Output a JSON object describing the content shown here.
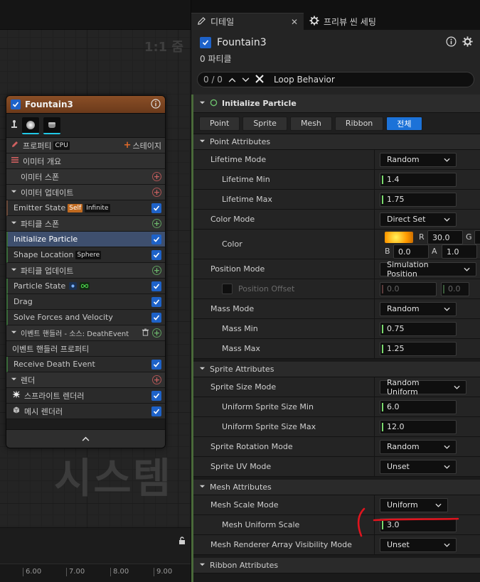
{
  "graph": {
    "zoom_label": "1:1 줌",
    "watermark": "시스템",
    "ticks": [
      "6.00",
      "7.00",
      "8.00",
      "9.00"
    ]
  },
  "node": {
    "title": "Fountain3",
    "properties_label": "프로퍼티",
    "cpu_badge": "CPU",
    "add_stage_label": "스테이지",
    "rows": {
      "emitter_summary": "이미터 개요",
      "emitter_spawn": "이미터 스폰",
      "emitter_update": "이미터 업데이트",
      "emitter_state": "Emitter State",
      "emitter_state_tag1": "Self",
      "emitter_state_tag2": "Infinite",
      "particle_spawn": "파티클 스폰",
      "initialize_particle": "Initialize Particle",
      "shape_location": "Shape Location",
      "shape_location_tag": "Sphere",
      "particle_update": "파티클 업데이트",
      "particle_state": "Particle State",
      "drag": "Drag",
      "solve_forces": "Solve Forces and Velocity",
      "event_handler": "이벤트 핸들러 - 소스: DeathEvent",
      "event_handler_props": "이벤트 핸들러 프로퍼티",
      "receive_death": "Receive Death Event",
      "render": "렌더",
      "sprite_renderer": "스프라이트 렌더러",
      "mesh_renderer": "메시 렌더러"
    }
  },
  "details": {
    "tab_details": "디테일",
    "tab_preview": "프리뷰 씬 세팅",
    "object_name": "Fountain3",
    "particle_count": "0 파티클",
    "search_count": "0 / 0",
    "search_text": "Loop Behavior",
    "category": "Initialize Particle",
    "filters": [
      "Point",
      "Sprite",
      "Mesh",
      "Ribbon",
      "전체"
    ],
    "sections": {
      "point": "Point Attributes",
      "sprite": "Sprite Attributes",
      "mesh": "Mesh Attributes",
      "ribbon": "Ribbon Attributes"
    },
    "props": {
      "lifetime_mode": {
        "label": "Lifetime Mode",
        "value": "Random"
      },
      "lifetime_min": {
        "label": "Lifetime Min",
        "value": "1.4"
      },
      "lifetime_max": {
        "label": "Lifetime Max",
        "value": "1.75"
      },
      "color_mode": {
        "label": "Color Mode",
        "value": "Direct Set"
      },
      "color": {
        "label": "Color",
        "r_label": "R",
        "r": "30.0",
        "g_label": "G",
        "b_label": "B",
        "b": "0.0",
        "a_label": "A",
        "a": "1.0",
        "swatch": "#ff9a00"
      },
      "position_mode": {
        "label": "Position Mode",
        "value": "Simulation Position"
      },
      "position_offset": {
        "label": "Position Offset",
        "x": "0.0",
        "y": "0.0"
      },
      "mass_mode": {
        "label": "Mass Mode",
        "value": "Random"
      },
      "mass_min": {
        "label": "Mass Min",
        "value": "0.75"
      },
      "mass_max": {
        "label": "Mass Max",
        "value": "1.25"
      },
      "sprite_size_mode": {
        "label": "Sprite Size Mode",
        "value": "Random Uniform"
      },
      "usize_min": {
        "label": "Uniform Sprite Size Min",
        "value": "6.0"
      },
      "usize_max": {
        "label": "Uniform Sprite Size Max",
        "value": "12.0"
      },
      "sprite_rot_mode": {
        "label": "Sprite Rotation Mode",
        "value": "Random"
      },
      "sprite_uv_mode": {
        "label": "Sprite UV Mode",
        "value": "Unset"
      },
      "mesh_scale_mode": {
        "label": "Mesh Scale Mode",
        "value": "Uniform"
      },
      "mesh_uniform_scale": {
        "label": "Mesh Uniform Scale",
        "value": "3.0"
      },
      "mesh_vis_mode": {
        "label": "Mesh Renderer Array Visibility Mode",
        "value": "Unset"
      }
    }
  },
  "colors": {
    "accent": "#1c72d8",
    "node_header": "#8a4e26",
    "annotation": "#e0141e"
  }
}
